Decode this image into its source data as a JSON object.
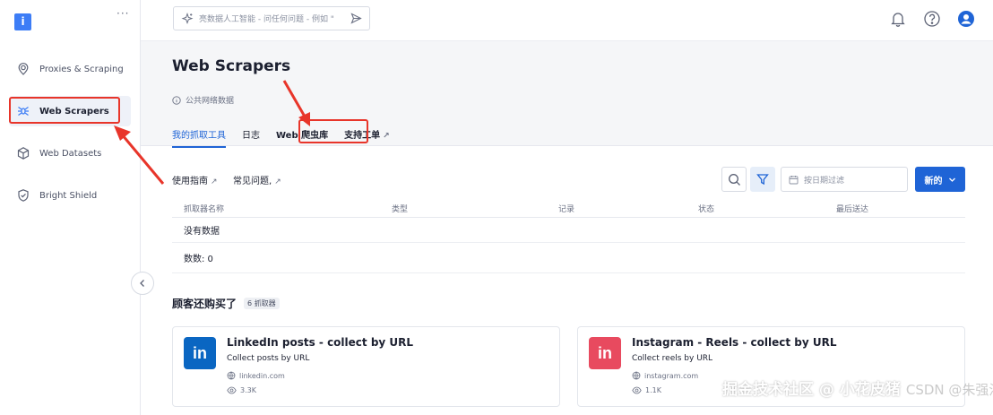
{
  "sidebar": {
    "logo_glyph": "i",
    "more_glyph": "···",
    "items": [
      {
        "label": "Proxies & Scraping",
        "icon": "location-pin-icon"
      },
      {
        "label": "Web Scrapers",
        "icon": "spider-icon",
        "active": true
      },
      {
        "label": "Web Datasets",
        "icon": "cube-icon"
      },
      {
        "label": "Bright Shield",
        "icon": "shield-icon"
      }
    ]
  },
  "topbar": {
    "search_placeholder": "亮数据人工智能 - 问任何问题 - 例如 \""
  },
  "page": {
    "title": "Web Scrapers",
    "subtitle": "公共网络数据",
    "tabs": [
      {
        "label": "我的抓取工具",
        "active": true
      },
      {
        "label": "日志"
      },
      {
        "label": "Web 爬虫库",
        "highlighted": true
      },
      {
        "label": "支持工单",
        "external": true
      }
    ]
  },
  "toolbar": {
    "guide_label": "使用指南",
    "faq_label": "常见问题,",
    "date_placeholder": "按日期过滤",
    "new_label": "新的"
  },
  "table": {
    "columns": [
      "抓取器名称",
      "类型",
      "记录",
      "状态",
      "最后送达"
    ],
    "empty_text": "没有数据",
    "count_text": "数数: 0"
  },
  "recommend": {
    "title": "顾客还购买了",
    "badge": "6 抓取器",
    "cards": [
      {
        "logo": "in",
        "title": "LinkedIn posts - collect by URL",
        "desc": "Collect posts by URL",
        "domain": "linkedin.com",
        "views": "3.3K",
        "color": "#0a66c2"
      },
      {
        "logo": "in",
        "title": "Instagram - Reels - collect by URL",
        "desc": "Collect reels by URL",
        "domain": "instagram.com",
        "views": "1.1K",
        "color": "#e84a5f"
      }
    ]
  },
  "watermark": {
    "text": "掘金技术社区 @ 小花皮猪",
    "faint": "CSDN @朱强治汪"
  },
  "colors": {
    "primary": "#1f64d6",
    "annotation": "#e8352a"
  }
}
